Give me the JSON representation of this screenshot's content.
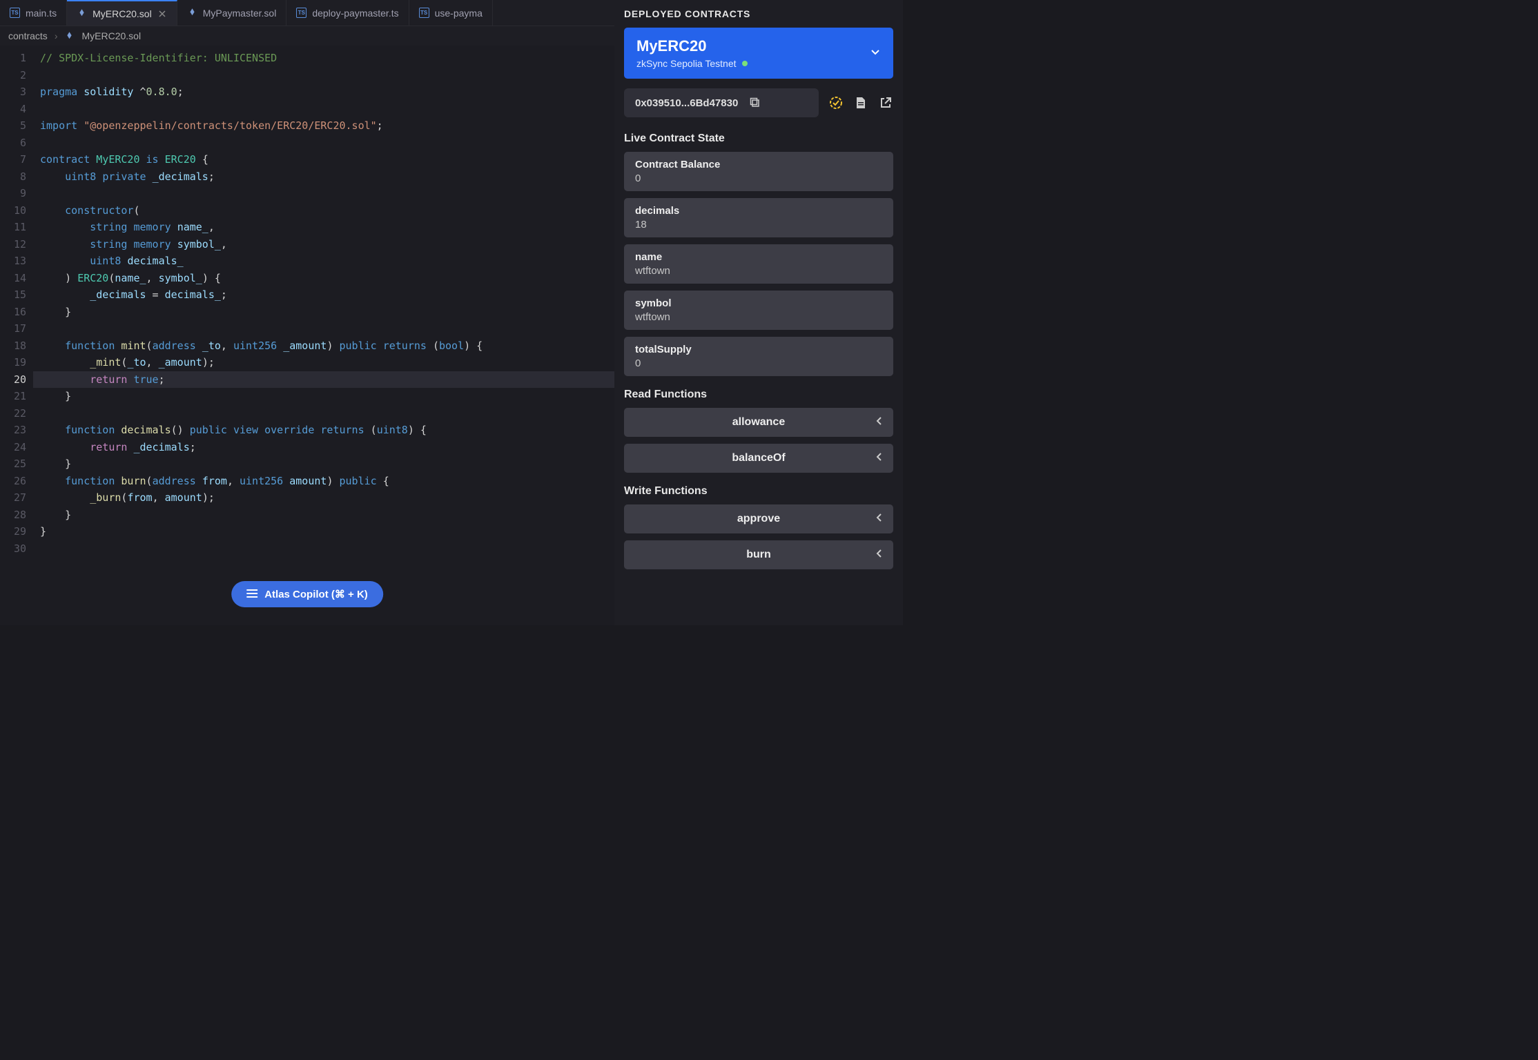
{
  "tabs": [
    {
      "label": "main.ts",
      "icon": "ts"
    },
    {
      "label": "MyERC20.sol",
      "icon": "sol",
      "active": true
    },
    {
      "label": "MyPaymaster.sol",
      "icon": "sol"
    },
    {
      "label": "deploy-paymaster.ts",
      "icon": "ts"
    },
    {
      "label": "use-payma",
      "icon": "ts"
    }
  ],
  "breadcrumb": {
    "folder": "contracts",
    "file": "MyERC20.sol"
  },
  "code_lines": [
    [
      [
        "comment",
        "// SPDX-License-Identifier: UNLICENSED"
      ]
    ],
    [],
    [
      [
        "kw",
        "pragma "
      ],
      [
        "id",
        "solidity "
      ],
      [
        "plain",
        "^"
      ],
      [
        "num",
        "0.8.0"
      ],
      [
        "plain",
        ";"
      ]
    ],
    [],
    [
      [
        "kw",
        "import "
      ],
      [
        "str",
        "\"@openzeppelin/contracts/token/ERC20/ERC20.sol\""
      ],
      [
        "plain",
        ";"
      ]
    ],
    [],
    [
      [
        "kw",
        "contract "
      ],
      [
        "type",
        "MyERC20 "
      ],
      [
        "kw",
        "is "
      ],
      [
        "type",
        "ERC20 "
      ],
      [
        "plain",
        "{"
      ]
    ],
    [
      [
        "plain",
        "    "
      ],
      [
        "kw",
        "uint8 "
      ],
      [
        "kw",
        "private "
      ],
      [
        "id",
        "_decimals"
      ],
      [
        "plain",
        ";"
      ]
    ],
    [],
    [
      [
        "plain",
        "    "
      ],
      [
        "kw",
        "constructor"
      ],
      [
        "plain",
        "("
      ]
    ],
    [
      [
        "plain",
        "        "
      ],
      [
        "kw",
        "string "
      ],
      [
        "kw",
        "memory "
      ],
      [
        "id",
        "name_"
      ],
      [
        "plain",
        ","
      ]
    ],
    [
      [
        "plain",
        "        "
      ],
      [
        "kw",
        "string "
      ],
      [
        "kw",
        "memory "
      ],
      [
        "id",
        "symbol_"
      ],
      [
        "plain",
        ","
      ]
    ],
    [
      [
        "plain",
        "        "
      ],
      [
        "kw",
        "uint8 "
      ],
      [
        "id",
        "decimals_"
      ]
    ],
    [
      [
        "plain",
        "    ) "
      ],
      [
        "type",
        "ERC20"
      ],
      [
        "plain",
        "("
      ],
      [
        "id",
        "name_"
      ],
      [
        "plain",
        ", "
      ],
      [
        "id",
        "symbol_"
      ],
      [
        "plain",
        ") {"
      ]
    ],
    [
      [
        "plain",
        "        "
      ],
      [
        "id",
        "_decimals"
      ],
      [
        "plain",
        " = "
      ],
      [
        "id",
        "decimals_"
      ],
      [
        "plain",
        ";"
      ]
    ],
    [
      [
        "plain",
        "    }"
      ]
    ],
    [],
    [
      [
        "plain",
        "    "
      ],
      [
        "kw",
        "function "
      ],
      [
        "fn",
        "mint"
      ],
      [
        "plain",
        "("
      ],
      [
        "kw",
        "address "
      ],
      [
        "id",
        "_to"
      ],
      [
        "plain",
        ", "
      ],
      [
        "kw",
        "uint256 "
      ],
      [
        "id",
        "_amount"
      ],
      [
        "plain",
        ") "
      ],
      [
        "kw",
        "public "
      ],
      [
        "kw",
        "returns "
      ],
      [
        "plain",
        "("
      ],
      [
        "kw",
        "bool"
      ],
      [
        "plain",
        ") {"
      ]
    ],
    [
      [
        "plain",
        "        "
      ],
      [
        "fn",
        "_mint"
      ],
      [
        "plain",
        "("
      ],
      [
        "id",
        "_to"
      ],
      [
        "plain",
        ", "
      ],
      [
        "id",
        "_amount"
      ],
      [
        "plain",
        ");"
      ]
    ],
    [
      [
        "plain",
        "        "
      ],
      [
        "mod",
        "return "
      ],
      [
        "kw",
        "true"
      ],
      [
        "plain",
        ";"
      ]
    ],
    [
      [
        "plain",
        "    }"
      ]
    ],
    [],
    [
      [
        "plain",
        "    "
      ],
      [
        "kw",
        "function "
      ],
      [
        "fn",
        "decimals"
      ],
      [
        "plain",
        "() "
      ],
      [
        "kw",
        "public "
      ],
      [
        "kw",
        "view "
      ],
      [
        "kw",
        "override "
      ],
      [
        "kw",
        "returns "
      ],
      [
        "plain",
        "("
      ],
      [
        "kw",
        "uint8"
      ],
      [
        "plain",
        ") {"
      ]
    ],
    [
      [
        "plain",
        "        "
      ],
      [
        "mod",
        "return "
      ],
      [
        "id",
        "_decimals"
      ],
      [
        "plain",
        ";"
      ]
    ],
    [
      [
        "plain",
        "    }"
      ]
    ],
    [
      [
        "plain",
        "    "
      ],
      [
        "kw",
        "function "
      ],
      [
        "fn",
        "burn"
      ],
      [
        "plain",
        "("
      ],
      [
        "kw",
        "address "
      ],
      [
        "id",
        "from"
      ],
      [
        "plain",
        ", "
      ],
      [
        "kw",
        "uint256 "
      ],
      [
        "id",
        "amount"
      ],
      [
        "plain",
        ") "
      ],
      [
        "kw",
        "public "
      ],
      [
        "plain",
        "{"
      ]
    ],
    [
      [
        "plain",
        "        "
      ],
      [
        "fn",
        "_burn"
      ],
      [
        "plain",
        "("
      ],
      [
        "id",
        "from"
      ],
      [
        "plain",
        ", "
      ],
      [
        "id",
        "amount"
      ],
      [
        "plain",
        ");"
      ]
    ],
    [
      [
        "plain",
        "    }"
      ]
    ],
    [
      [
        "plain",
        "}"
      ]
    ],
    []
  ],
  "active_line": 20,
  "copilot_label": "Atlas Copilot (⌘ + K)",
  "sidebar": {
    "title": "DEPLOYED CONTRACTS",
    "contract": {
      "name": "MyERC20",
      "network": "zkSync Sepolia Testnet"
    },
    "address": "0x039510...6Bd47830",
    "live_state_title": "Live Contract State",
    "state": [
      {
        "label": "Contract Balance",
        "value": "0"
      },
      {
        "label": "decimals",
        "value": "18"
      },
      {
        "label": "name",
        "value": "wtftown"
      },
      {
        "label": "symbol",
        "value": "wtftown"
      },
      {
        "label": "totalSupply",
        "value": "0"
      }
    ],
    "read_title": "Read Functions",
    "read_fns": [
      "allowance",
      "balanceOf"
    ],
    "write_title": "Write Functions",
    "write_fns": [
      "approve",
      "burn"
    ]
  }
}
